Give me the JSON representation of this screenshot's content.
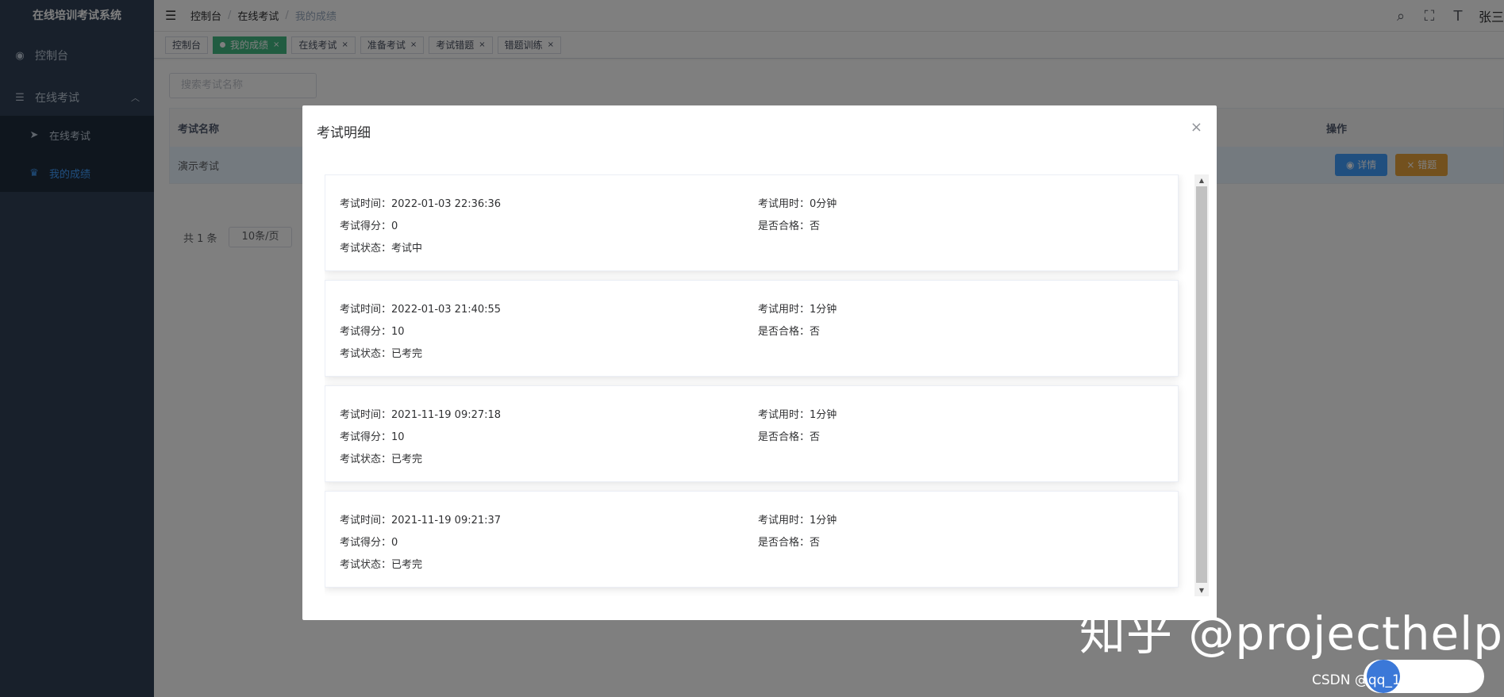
{
  "sidebar": {
    "title": "在线培训考试系统",
    "items": [
      {
        "label": "控制台",
        "icon": "dashboard-icon"
      },
      {
        "label": "在线考试",
        "icon": "list-icon"
      }
    ],
    "submenu": [
      {
        "label": "在线考试",
        "icon": "send-icon"
      },
      {
        "label": "我的成绩",
        "icon": "trophy-icon",
        "active": true
      }
    ]
  },
  "navbar": {
    "breadcrumb": [
      "控制台",
      "在线考试",
      "我的成绩"
    ],
    "user": "张三"
  },
  "tags": [
    {
      "label": "控制台",
      "active": false,
      "closable": false
    },
    {
      "label": "我的成绩",
      "active": true,
      "closable": true
    },
    {
      "label": "在线考试",
      "active": false,
      "closable": true
    },
    {
      "label": "准备考试",
      "active": false,
      "closable": true
    },
    {
      "label": "考试错题",
      "active": false,
      "closable": true
    },
    {
      "label": "错题训练",
      "active": false,
      "closable": true
    }
  ],
  "search": {
    "placeholder": "搜索考试名称"
  },
  "table": {
    "headers": {
      "name": "考试名称",
      "ops": "操作"
    },
    "rows": [
      {
        "name": "演示考试",
        "detail": "详情",
        "wrong": "错题"
      }
    ]
  },
  "pager": {
    "total": "共 1 条",
    "size": "10条/页"
  },
  "dialog": {
    "title": "考试明细",
    "records": [
      {
        "time": "考试时间：2022-01-03 22:36:36",
        "score": "考试得分：0",
        "status": "考试状态：考试中",
        "used": "考试用时：0分钟",
        "pass": "是否合格：否"
      },
      {
        "time": "考试时间：2022-01-03 21:40:55",
        "score": "考试得分：10",
        "status": "考试状态：已考完",
        "used": "考试用时：1分钟",
        "pass": "是否合格：否"
      },
      {
        "time": "考试时间：2021-11-19 09:27:18",
        "score": "考试得分：10",
        "status": "考试状态：已考完",
        "used": "考试用时：1分钟",
        "pass": "是否合格：否"
      },
      {
        "time": "考试时间：2021-11-19 09:21:37",
        "score": "考试得分：0",
        "status": "考试状态：已考完",
        "used": "考试用时：1分钟",
        "pass": "是否合格：否"
      }
    ]
  },
  "watermark": {
    "zhihu": "知乎 @projecthelp",
    "csdn": "CSDN @qq_1808614304"
  },
  "colors": {
    "sidebar": "#304156",
    "primary": "#409eff",
    "warning": "#e6a23c",
    "tag_active": "#42b983"
  }
}
